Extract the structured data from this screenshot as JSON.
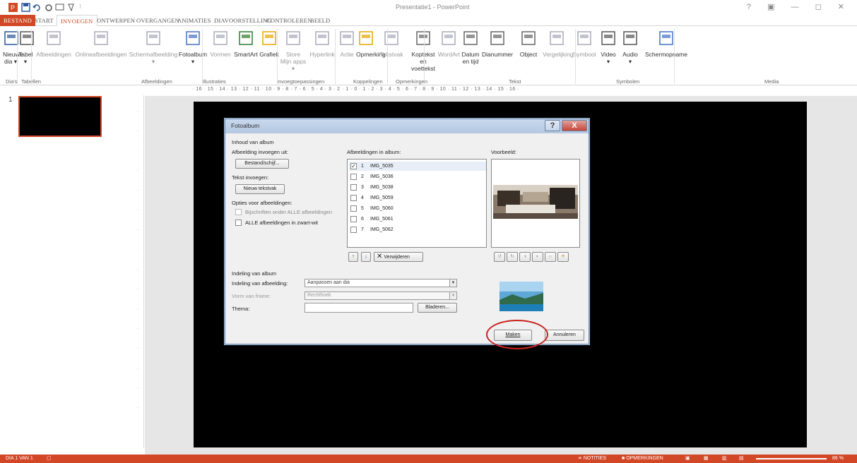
{
  "window": {
    "title": "Presentatie1 - PowerPoint",
    "controls": "? ▣ — ◻ ✕"
  },
  "tabs": [
    {
      "label": "BESTAND",
      "active": false,
      "file": true
    },
    {
      "label": "START",
      "active": false
    },
    {
      "label": "INVOEGEN",
      "active": true
    },
    {
      "label": "ONTWERPEN",
      "active": false
    },
    {
      "label": "OVERGANGEN",
      "active": false
    },
    {
      "label": "ANIMATIES",
      "active": false
    },
    {
      "label": "DIAVOORSTELLING",
      "active": false
    },
    {
      "label": "CONTROLEREN",
      "active": false
    },
    {
      "label": "BEELD",
      "active": false
    }
  ],
  "ribbon": {
    "buttons": [
      {
        "id": "nieuwe-dia",
        "l1": "Nieuwe",
        "l2": "dia ▾",
        "icon": "new-slide-icon",
        "dim": false
      },
      {
        "id": "tabel",
        "l1": "Tabel",
        "l2": "▾",
        "icon": "table-icon",
        "dim": false
      },
      {
        "id": "afbeeldingen",
        "l1": "Afbeeldingen",
        "l2": "",
        "icon": "image-icon",
        "dim": true
      },
      {
        "id": "onlineafbeeldingen",
        "l1": "Onlineafbeeldingen",
        "l2": "",
        "icon": "online-image-icon",
        "dim": true
      },
      {
        "id": "schermafbeelding",
        "l1": "Schermafbeelding",
        "l2": "▾",
        "icon": "screenshot-icon",
        "dim": true
      },
      {
        "id": "fotoalbum",
        "l1": "Fotoalbum",
        "l2": "▾",
        "icon": "photo-album-icon",
        "dim": false
      },
      {
        "id": "vormen",
        "l1": "Vormen",
        "l2": "",
        "icon": "shapes-icon",
        "dim": true
      },
      {
        "id": "smartart",
        "l1": "SmartArt",
        "l2": "",
        "icon": "smartart-icon",
        "dim": false
      },
      {
        "id": "grafiek",
        "l1": "Grafiek",
        "l2": "",
        "icon": "chart-icon",
        "dim": false
      },
      {
        "id": "store",
        "l1": "Store",
        "l2": "Mijn apps ▾",
        "icon": "store-icon",
        "dim": true
      },
      {
        "id": "hyperlink",
        "l1": "Hyperlink",
        "l2": "",
        "icon": "hyperlink-icon",
        "dim": true
      },
      {
        "id": "actie",
        "l1": "Actie",
        "l2": "",
        "icon": "action-icon",
        "dim": true
      },
      {
        "id": "opmerking",
        "l1": "Opmerking",
        "l2": "",
        "icon": "comment-icon",
        "dim": false
      },
      {
        "id": "tekstvak",
        "l1": "Tekstvak",
        "l2": "",
        "icon": "textbox-icon",
        "dim": true
      },
      {
        "id": "koptekst",
        "l1": "Koptekst en",
        "l2": "voettekst",
        "icon": "header-footer-icon",
        "dim": false
      },
      {
        "id": "wordart",
        "l1": "WordArt",
        "l2": "",
        "icon": "wordart-icon",
        "dim": true
      },
      {
        "id": "datum",
        "l1": "Datum",
        "l2": "en tijd",
        "icon": "date-time-icon",
        "dim": false
      },
      {
        "id": "dianummer",
        "l1": "Dianummer",
        "l2": "",
        "icon": "slide-number-icon",
        "dim": false
      },
      {
        "id": "object",
        "l1": "Object",
        "l2": "",
        "icon": "object-icon",
        "dim": false
      },
      {
        "id": "vergelijking",
        "l1": "Vergelijking",
        "l2": "",
        "icon": "equation-icon",
        "dim": true
      },
      {
        "id": "symbool",
        "l1": "Symbool",
        "l2": "",
        "icon": "symbol-icon",
        "dim": true
      },
      {
        "id": "video",
        "l1": "Video",
        "l2": "▾",
        "icon": "video-icon",
        "dim": false
      },
      {
        "id": "audio",
        "l1": "Audio",
        "l2": "▾",
        "icon": "audio-icon",
        "dim": false
      },
      {
        "id": "schermopname",
        "l1": "Schermopname",
        "l2": "",
        "icon": "screen-recording-icon",
        "dim": false
      }
    ],
    "groups": [
      "Dia's",
      "Tabellen",
      "Afbeeldingen",
      "Illustraties",
      "Invoegtoepassingen",
      "Koppelingen",
      "Opmerkingen",
      "Tekst",
      "Symbolen",
      "Media"
    ]
  },
  "ruler": "· 16 · 15 · 14 · 13 · 12 · 11 · 10 · 9 · 8 · 7 · 6 · 5 · 4 · 3 · 2 · 1 · 0 · 1 · 2 · 3 · 4 · 5 · 6 · 7 · 8 · 9 · 10 · 11 · 12 · 13 · 14 · 15 · 16 ·",
  "thumb_number": "1",
  "dialog": {
    "title": "Fotoalbum",
    "help": "?",
    "close": "X",
    "section_album_content": "Inhoud van album",
    "insert_from": "Afbeelding invoegen uit:",
    "file_disk_button": "Bestand/schijf...",
    "insert_text": "Tekst invoegen:",
    "new_textbox_button": "Nieuw tekstvak",
    "picture_options": "Opties voor afbeeldingen:",
    "captions_option": "Bijschriften onder ALLE afbeeldingen",
    "bw_option": "ALLE afbeeldingen in zwart-wit",
    "pictures_in_album": "Afbeeldingen in album:",
    "pictures": [
      {
        "num": "1",
        "name": "IMG_5035",
        "checked": true
      },
      {
        "num": "2",
        "name": "IMG_5036",
        "checked": false
      },
      {
        "num": "3",
        "name": "IMG_5038",
        "checked": false
      },
      {
        "num": "4",
        "name": "IMG_5059",
        "checked": false
      },
      {
        "num": "5",
        "name": "IMG_5060",
        "checked": false
      },
      {
        "num": "6",
        "name": "IMG_5061",
        "checked": false
      },
      {
        "num": "7",
        "name": "IMG_5062",
        "checked": false
      }
    ],
    "remove_button": "Verwijderen",
    "preview_label": "Voorbeeld:",
    "layout_section": "Indeling van album",
    "picture_layout_label": "Indeling van afbeelding:",
    "picture_layout_value": "Aanpassen aan dia",
    "frame_shape_label": "Vorm van frame:",
    "frame_shape_value": "Rechthoek",
    "theme_label": "Thema:",
    "theme_value": "",
    "browse_button": "Bladeren...",
    "create_button": "Maken",
    "cancel_button": "Annuleren"
  },
  "status": {
    "slide": "DIA 1 VAN 1",
    "notes": "NOTITIES",
    "comments": "OPMERKINGEN",
    "zoom": "86 %"
  }
}
